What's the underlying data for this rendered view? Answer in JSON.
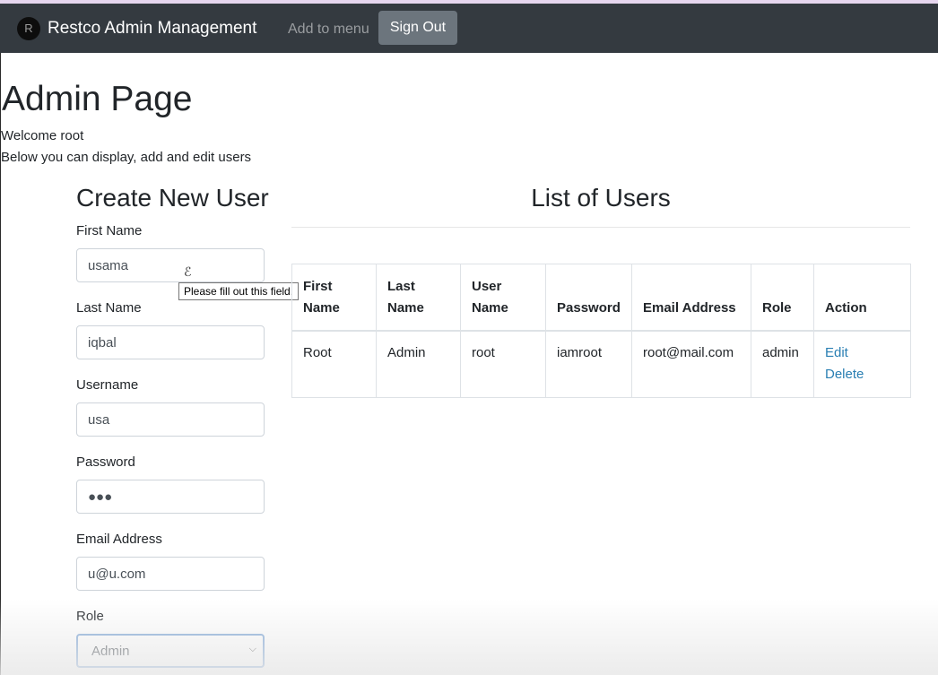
{
  "navbar": {
    "logo_letter": "R",
    "brand": "Restco Admin Management",
    "add_to_menu": "Add to menu",
    "sign_out": "Sign Out"
  },
  "page": {
    "title": "Admin Page",
    "welcome": "Welcome root",
    "description": "Below you can display, add and edit users"
  },
  "form": {
    "title": "Create New User",
    "first_name_label": "First Name",
    "first_name_value": "usama",
    "last_name_label": "Last Name",
    "last_name_value": "iqbal",
    "username_label": "Username",
    "username_value": "usa",
    "password_label": "Password",
    "password_value": "●●●",
    "email_label": "Email Address",
    "email_value": "u@u.com",
    "role_label": "Role",
    "role_value": "Admin",
    "tooltip": "Please fill out this field."
  },
  "users": {
    "title": "List of Users",
    "columns": [
      "First Name",
      "Last Name",
      "User Name",
      "Password",
      "Email Address",
      "Role",
      "Action"
    ],
    "rows": [
      {
        "first_name": "Root",
        "last_name": "Admin",
        "user_name": "root",
        "password": "iamroot",
        "email": "root@mail.com",
        "role": "admin",
        "edit": "Edit",
        "delete": "Delete"
      }
    ]
  },
  "colors": {
    "navbar": "#343a40",
    "secondary_button": "#6c757d",
    "link": "#2a7fb3"
  }
}
